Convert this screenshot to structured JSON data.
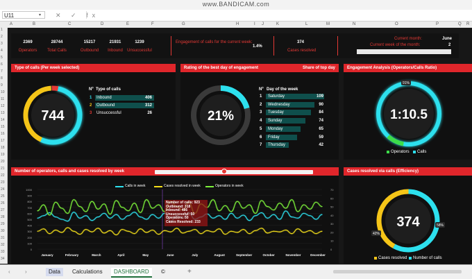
{
  "recording": {
    "watermark": "www.BANDICAM.com"
  },
  "formula_bar": {
    "name_box": "U11",
    "fx_symbols": "✕ ✓ fx"
  },
  "columns": [
    "A",
    "B",
    "C",
    "D",
    "E",
    "F",
    "G",
    "H",
    "I",
    "J",
    "K",
    "L",
    "M",
    "N",
    "O",
    "P",
    "Q",
    "R",
    "S"
  ],
  "rows": [
    "1",
    "2",
    "3",
    "4",
    "5",
    "6",
    "7",
    "8",
    "9",
    "10",
    "11",
    "12",
    "13",
    "14",
    "15",
    "16",
    "17",
    "18",
    "19",
    "20",
    "21",
    "22",
    "23",
    "24",
    "25",
    "26",
    "27",
    "28",
    "29",
    "30",
    "31",
    "32",
    "33",
    "34"
  ],
  "kpis": [
    {
      "value": "2369",
      "label": "Operators"
    },
    {
      "value": "28744",
      "label": "Total Calls"
    },
    {
      "value": "15217",
      "label": "Outbound"
    },
    {
      "value": "21931",
      "label": "Inbound"
    },
    {
      "value": "1239",
      "label": "Unsuccessful"
    }
  ],
  "engagement": {
    "label": "Engagement of calls for the current week:",
    "value": "1.4%"
  },
  "cases_resolved": {
    "value": "374",
    "label": "Cases resolved"
  },
  "current": {
    "month_label": "Current month:",
    "month_value": "June",
    "week_label": "Current week of the month:",
    "week_value": "2"
  },
  "type_of_calls": {
    "title": "Type of calls (Per week selected)",
    "center": "744",
    "col_no": "Nº",
    "col_type": "Type of calls",
    "rows": [
      {
        "no": "1",
        "label": "Inbound",
        "value": "406",
        "color": "#2de0ee"
      },
      {
        "no": "2",
        "label": "Outbound",
        "value": "312",
        "color": "#f5c518"
      },
      {
        "no": "3",
        "label": "Unsuccessful",
        "value": "26",
        "color": "#e53935"
      }
    ]
  },
  "rating": {
    "title": "Rating of the best day of engagement",
    "share_label": "Share of top day",
    "center": "21%",
    "col_no": "Nº",
    "col_day": "Day of the week",
    "rows": [
      {
        "no": "1",
        "day": "Saturday",
        "value": "109",
        "pct": 1.0
      },
      {
        "no": "2",
        "day": "Wednesday",
        "value": "90",
        "pct": 0.83
      },
      {
        "no": "3",
        "day": "Tuesday",
        "value": "84",
        "pct": 0.77
      },
      {
        "no": "4",
        "day": "Sunday",
        "value": "74",
        "pct": 0.68
      },
      {
        "no": "5",
        "day": "Monday",
        "value": "65",
        "pct": 0.6
      },
      {
        "no": "6",
        "day": "Friday",
        "value": "59",
        "pct": 0.54
      },
      {
        "no": "7",
        "day": "Thursday",
        "value": "42",
        "pct": 0.39
      }
    ]
  },
  "engagement_analysis": {
    "title": "Engagement Analysis (Operators/Calls Ratio)",
    "center": "1:10.5",
    "pct_label": "91%",
    "legend": [
      {
        "label": "Operators",
        "color": "#3ddc4a"
      },
      {
        "label": "Calls",
        "color": "#2de0ee"
      }
    ]
  },
  "line_chart": {
    "title": "Number of operators, calls and cases resolved by week",
    "legend": [
      {
        "label": "Calls in week",
        "color": "#2de0ee"
      },
      {
        "label": "Cases resolved in week",
        "color": "#f5e01a"
      },
      {
        "label": "Operators in week",
        "color": "#7cf03a"
      }
    ],
    "tooltip": [
      "Number of calls: 923",
      "Outbound: 318",
      "Inbound: 486",
      "Unsuccessful: 50",
      "Operators: 50",
      "Cases Resolved: 233"
    ]
  },
  "chart_data": {
    "type": "line",
    "title": "Number of operators, calls and cases resolved by week",
    "x": [
      "January",
      "February",
      "March",
      "April",
      "May",
      "June",
      "July",
      "August",
      "September",
      "October",
      "November",
      "December"
    ],
    "y_left_ticks": [
      "1000",
      "900",
      "800",
      "700",
      "600",
      "500",
      "400",
      "300",
      "200",
      "100",
      "0"
    ],
    "y_right_ticks": [
      "70",
      "60",
      "50",
      "40",
      "30",
      "20",
      "10",
      "0"
    ],
    "ylim": [
      0,
      1000
    ],
    "series": [
      {
        "name": "Calls in week",
        "color": "#2de0ee",
        "values": [
          520,
          560,
          610,
          540,
          500,
          470,
          620,
          520,
          560,
          480,
          540,
          600,
          520,
          580,
          500,
          560,
          620,
          540,
          500,
          580,
          520,
          600,
          470,
          560,
          520,
          610,
          500,
          540,
          590,
          520,
          560,
          500,
          600,
          520,
          570,
          480,
          560,
          610,
          520,
          580,
          500,
          640,
          540,
          520,
          600,
          560,
          500,
          580
        ]
      },
      {
        "name": "Cases resolved in week",
        "color": "#f5e01a",
        "values": [
          300,
          340,
          260,
          320,
          280,
          360,
          300,
          250,
          330,
          290,
          350,
          270,
          310,
          240,
          330,
          300,
          260,
          340,
          280,
          320,
          250,
          310,
          290,
          350,
          270,
          300,
          330,
          260,
          310,
          290,
          340,
          250,
          300,
          280,
          330,
          260,
          310,
          350,
          270,
          300,
          290,
          320,
          260,
          340,
          280,
          310,
          260,
          300
        ]
      },
      {
        "name": "Operators in week",
        "color": "#7cf03a",
        "values": [
          45,
          52,
          40,
          55,
          48,
          42,
          58,
          50,
          44,
          56,
          47,
          53,
          41,
          57,
          49,
          45,
          54,
          43,
          58,
          48,
          52,
          44,
          56,
          50,
          46,
          55,
          42,
          53,
          49,
          58,
          45,
          51,
          44,
          56,
          48,
          52,
          42,
          57,
          50,
          46,
          54,
          48,
          58,
          44,
          52,
          47,
          55,
          50
        ]
      }
    ]
  },
  "efficiency": {
    "title": "Cases resolved via calls (Efficiency)",
    "center": "374",
    "left_pct": "42%",
    "right_pct": "58%",
    "legend": [
      {
        "label": "Cases resolved",
        "color": "#f5c518"
      },
      {
        "label": "Number of calls",
        "color": "#2de0ee"
      }
    ]
  },
  "tabs": {
    "data": "Data",
    "calculations": "Calculations",
    "dashboard": "DASHBOARD",
    "copyright": "©",
    "add": "+"
  }
}
